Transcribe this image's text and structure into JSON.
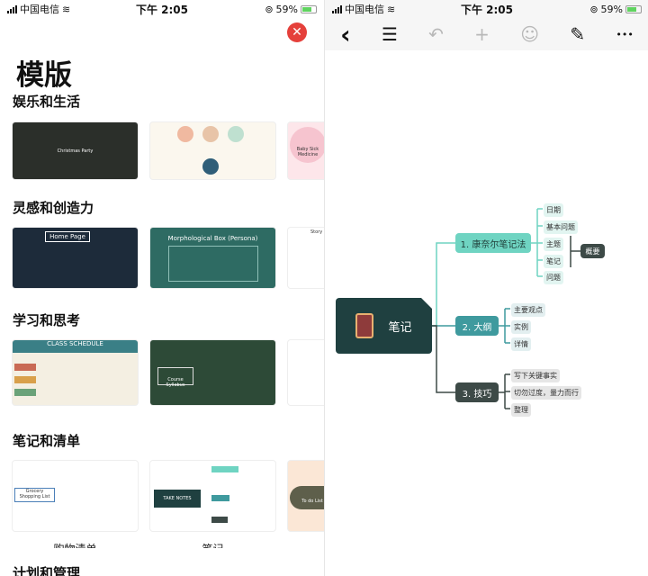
{
  "status_bar": {
    "carrier": "中国电信",
    "time": "下午 2:05",
    "battery": "59%"
  },
  "templates_panel": {
    "close_icon": "close-icon",
    "title": "模版",
    "sections": [
      {
        "title": "娱乐和生活",
        "thumbs": [
          {
            "text": "Christmas Party",
            "bg": "#2b2f2a"
          },
          {
            "text": "",
            "bg": "#fbf7ee"
          },
          {
            "text": "Baby Sick Medicine",
            "bg": "#fde6ea"
          }
        ]
      },
      {
        "title": "灵感和创造力",
        "thumbs": [
          {
            "text": "Home Page",
            "bg": "#1d2b3a"
          },
          {
            "text": "Morphological Box (Persona)",
            "bg": "#2e6b63"
          },
          {
            "text": "Story",
            "bg": "#ffffff"
          }
        ]
      },
      {
        "title": "学习和思考",
        "thumbs": [
          {
            "text": "CLASS SCHEDULE",
            "bg": "#f4efe2"
          },
          {
            "text": "Course Syllabus",
            "bg": "#2d4a37"
          },
          {
            "text": "",
            "bg": "#ffffff"
          }
        ]
      },
      {
        "title": "笔记和清单",
        "thumbs": [
          {
            "text": "Grocery Shopping List",
            "bg": "#ffffff"
          },
          {
            "text": "TAKE NOTES",
            "bg": "#ffffff"
          },
          {
            "text": "To do List",
            "bg": "#fbe7d6"
          }
        ],
        "captions": [
          "购物清单",
          "笔记"
        ]
      },
      {
        "title": "计划和管理"
      }
    ]
  },
  "editor": {
    "toolbar": {
      "back": "‹",
      "outline": "☰",
      "undo": "↶",
      "add": "+",
      "emoji": "☺",
      "style": "✎",
      "more": "•••"
    },
    "central": "笔记",
    "branches": [
      {
        "label": "1. 康奈尔笔记法",
        "color": "#6fd4c2",
        "leaves": [
          "日期",
          "基本问题",
          "主题",
          "笔记",
          "问题"
        ],
        "summary": "概要"
      },
      {
        "label": "2. 大纲",
        "color": "#3f9a9e",
        "leaves": [
          "主要观点",
          "实例",
          "详情"
        ]
      },
      {
        "label": "3. 技巧",
        "color": "#3d4a47",
        "leaves": [
          "写下关键事实",
          "切勿过度，量力而行",
          "整理"
        ]
      }
    ]
  }
}
